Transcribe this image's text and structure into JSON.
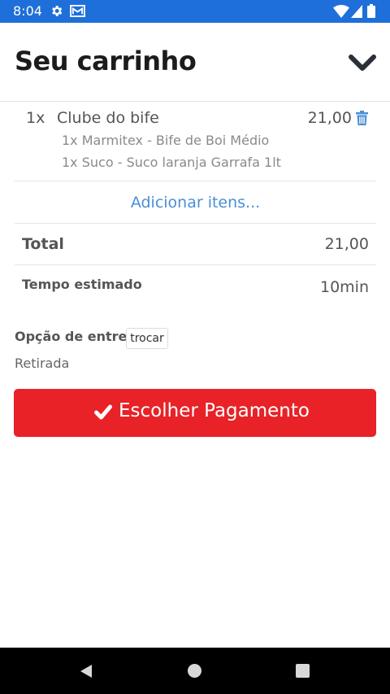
{
  "status_bar": {
    "time": "8:04",
    "icons": [
      "gear-icon",
      "mail-icon",
      "wifi-icon",
      "signal-icon",
      "battery-icon"
    ],
    "background_color": "#1e6fd9"
  },
  "header": {
    "title": "Seu carrinho",
    "collapse_icon": "chevron-down-icon"
  },
  "cart": {
    "items": [
      {
        "qty": "1x",
        "name": "Clube do bife",
        "price": "21,00",
        "options": [
          "1x Marmitex - Bife de Boi Médio",
          "1x Suco - Suco laranja Garrafa 1lt"
        ],
        "delete_icon": "trash-icon"
      }
    ],
    "add_items_label": "Adicionar itens...",
    "total_label": "Total",
    "total_value": "21,00",
    "time_label": "Tempo estimado",
    "time_value": "10min"
  },
  "delivery": {
    "label": "Opção de entrega",
    "change_button": "trocar",
    "value": "Retirada"
  },
  "payment_button": {
    "label": "Escolher Pagamento",
    "icon": "check-icon",
    "color": "#e82227"
  },
  "nav_bar": {
    "icons": [
      "back-icon",
      "home-icon",
      "recents-icon"
    ]
  },
  "colors": {
    "accent_link": "#4a8fd6",
    "trash": "#4a8fd6"
  }
}
